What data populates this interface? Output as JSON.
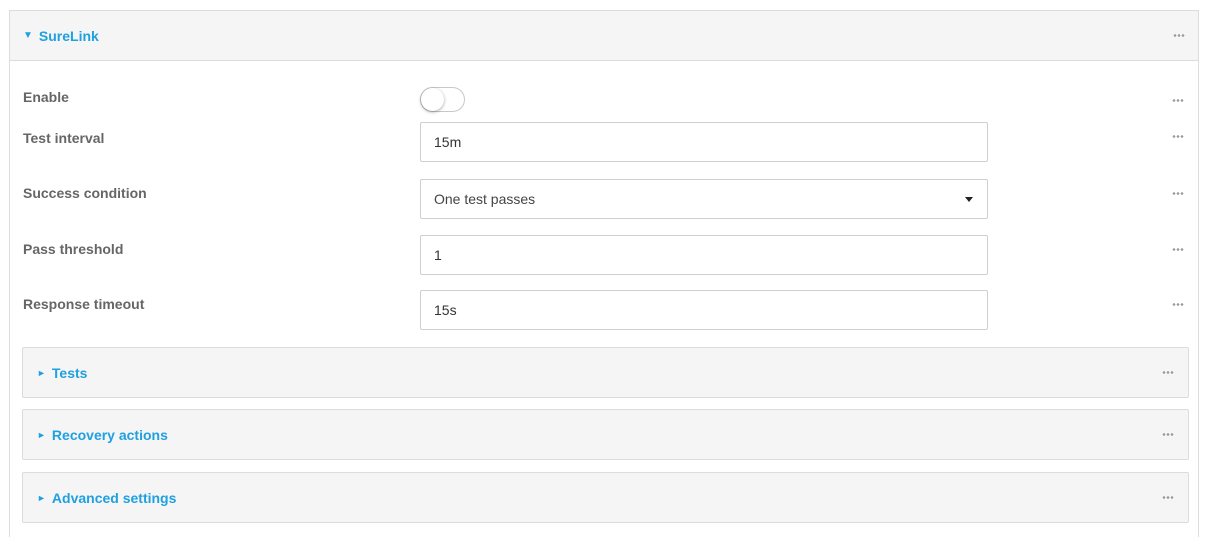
{
  "surelink": {
    "title": "SureLink",
    "expanded": true,
    "fields": {
      "enable": {
        "label": "Enable",
        "value": false
      },
      "test_interval": {
        "label": "Test interval",
        "value": "15m"
      },
      "success_condition": {
        "label": "Success condition",
        "value": "One test passes"
      },
      "pass_threshold": {
        "label": "Pass threshold",
        "value": "1"
      },
      "response_timeout": {
        "label": "Response timeout",
        "value": "15s"
      }
    },
    "subsections": [
      {
        "title": "Tests"
      },
      {
        "title": "Recovery actions"
      },
      {
        "title": "Advanced settings"
      }
    ]
  },
  "icons": {
    "expanded_caret": "caret-down-icon",
    "collapsed_caret": "caret-right-icon",
    "more": "more-dots-icon",
    "dropdown": "chevron-down-icon"
  },
  "colors": {
    "accent": "#1fa0e0",
    "header_bg": "#f5f5f5",
    "border": "#dcdcdc",
    "label": "#666666"
  }
}
